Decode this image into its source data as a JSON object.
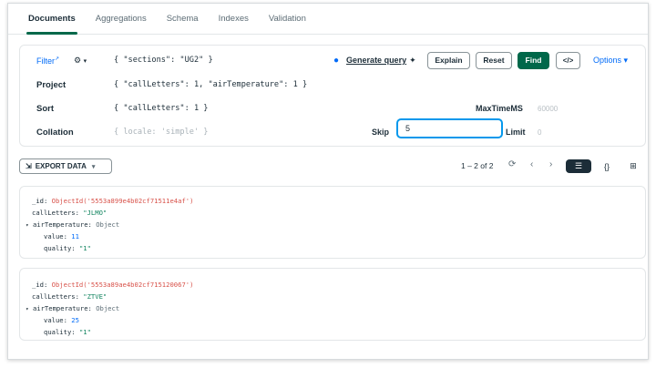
{
  "tabs": [
    "Documents",
    "Aggregations",
    "Schema",
    "Indexes",
    "Validation"
  ],
  "query": {
    "filter_label": "Filter",
    "filter_value": "{ \"sections\": \"UG2\" }",
    "generate_query": "Generate query",
    "buttons": {
      "explain": "Explain",
      "reset": "Reset",
      "find": "Find",
      "code": "</>"
    },
    "options": "Options ▾",
    "project_label": "Project",
    "project_value": "{ \"callLetters\": 1, \"airTemperature\": 1 }",
    "sort_label": "Sort",
    "sort_value": "{ \"callLetters\": 1 }",
    "maxtime_label": "MaxTimeMS",
    "maxtime_placeholder": "60000",
    "collation_label": "Collation",
    "collation_placeholder": "{ locale: 'simple' }",
    "skip_label": "Skip",
    "skip_value": "5",
    "limit_label": "Limit",
    "limit_placeholder": "0"
  },
  "results": {
    "export_label": "EXPORT DATA",
    "count": "1 – 2 of 2"
  },
  "documents": [
    {
      "id_value": "ObjectId('5553a899e4b02cf71511e4af')",
      "callLetters": "\"JLMO\"",
      "airTemperature_type": "Object",
      "value": "11",
      "quality": "\"1\""
    },
    {
      "id_value": "ObjectId('5553a89ae4b02cf715120067')",
      "callLetters": "\"ZTVE\"",
      "airTemperature_type": "Object",
      "value": "25",
      "quality": "\"1\""
    }
  ],
  "field_names": {
    "id": "_id:",
    "callLetters": "callLetters:",
    "airTemperature": "airTemperature:",
    "value": "value:",
    "quality": "quality:"
  },
  "colors": {
    "accent_green": "#00684a",
    "link_blue": "#016bf8",
    "focus_blue": "#0498ec"
  }
}
